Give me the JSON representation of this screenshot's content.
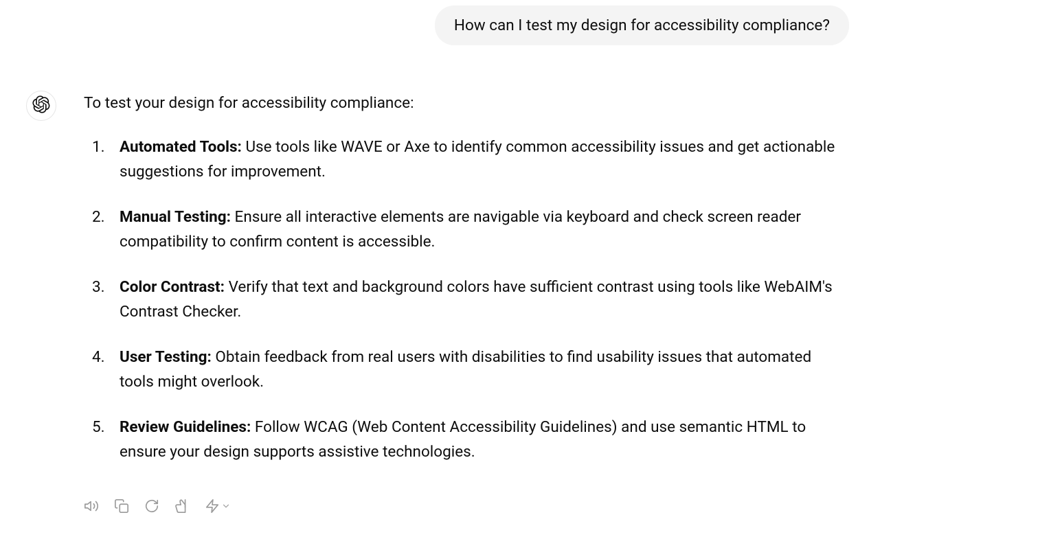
{
  "user_message": "How can I test my design for accessibility compliance?",
  "assistant": {
    "intro": "To test your design for accessibility compliance:",
    "steps": [
      {
        "title": "Automated Tools:",
        "body": " Use tools like WAVE or Axe to identify common accessibility issues and get actionable suggestions for improvement."
      },
      {
        "title": "Manual Testing:",
        "body": " Ensure all interactive elements are navigable via keyboard and check screen reader compatibility to confirm content is accessible."
      },
      {
        "title": "Color Contrast:",
        "body": " Verify that text and background colors have sufficient contrast using tools like WebAIM's Contrast Checker."
      },
      {
        "title": "User Testing:",
        "body": " Obtain feedback from real users with disabilities to find usability issues that automated tools might overlook."
      },
      {
        "title": "Review Guidelines:",
        "body": " Follow WCAG (Web Content Accessibility Guidelines) and use semantic HTML to ensure your design supports assistive technologies."
      }
    ]
  }
}
